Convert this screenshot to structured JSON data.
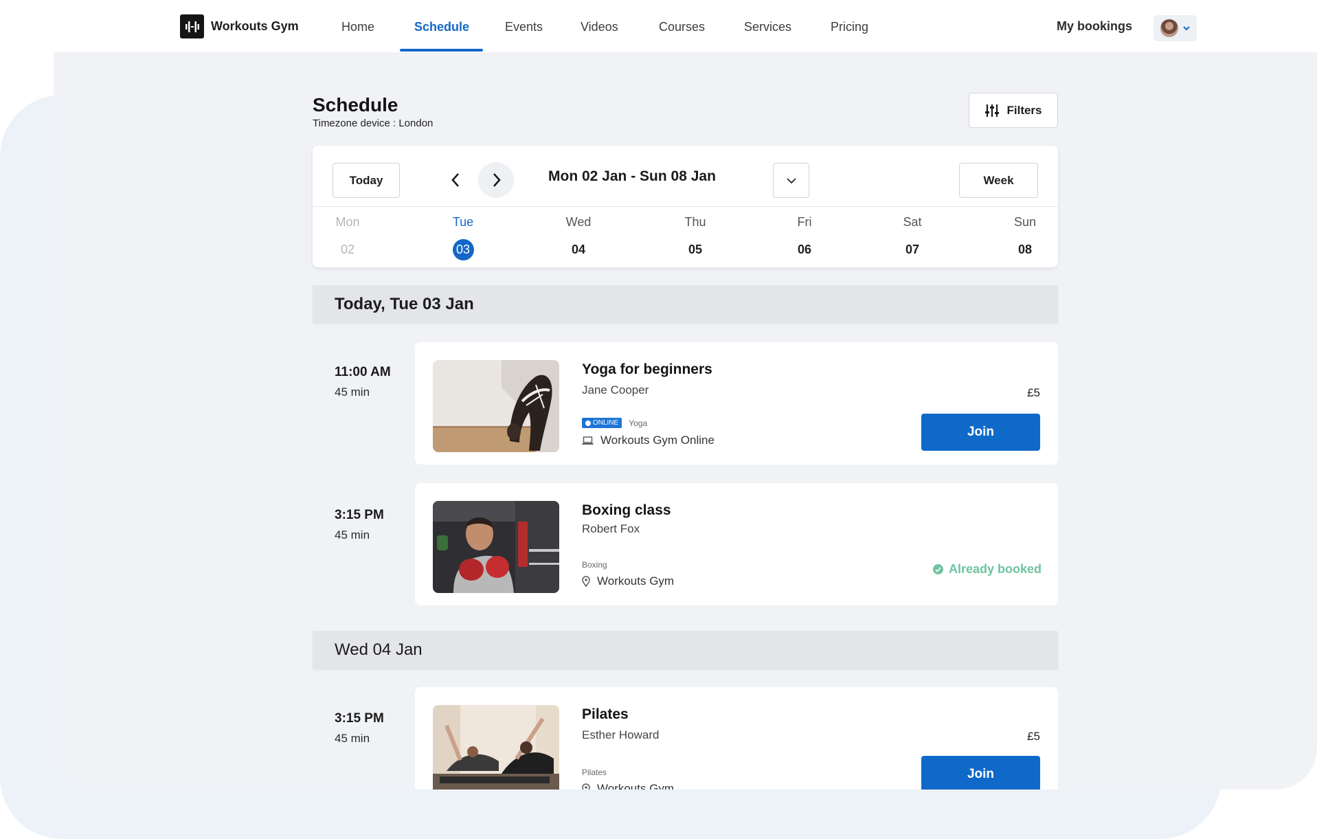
{
  "brand": {
    "name": "Workouts Gym"
  },
  "nav": {
    "items": [
      {
        "label": "Home"
      },
      {
        "label": "Schedule"
      },
      {
        "label": "Events"
      },
      {
        "label": "Videos"
      },
      {
        "label": "Courses"
      },
      {
        "label": "Services"
      },
      {
        "label": "Pricing"
      }
    ],
    "active": "Schedule",
    "my_bookings": "My bookings"
  },
  "page": {
    "title": "Schedule",
    "subtitle": "Timezone device : London",
    "filters_label": "Filters"
  },
  "calendar": {
    "today_label": "Today",
    "range": "Mon 02 Jan - Sun 08 Jan",
    "view_label": "Week",
    "days": [
      {
        "name": "Mon",
        "num": "02",
        "state": "past"
      },
      {
        "name": "Tue",
        "num": "03",
        "state": "selected"
      },
      {
        "name": "Wed",
        "num": "04",
        "state": "normal"
      },
      {
        "name": "Thu",
        "num": "05",
        "state": "normal"
      },
      {
        "name": "Fri",
        "num": "06",
        "state": "normal"
      },
      {
        "name": "Sat",
        "num": "07",
        "state": "normal"
      },
      {
        "name": "Sun",
        "num": "08",
        "state": "normal"
      }
    ]
  },
  "sections": [
    {
      "heading": "Today, Tue 03 Jan"
    },
    {
      "heading": "Wed 04 Jan"
    }
  ],
  "classes": [
    {
      "time": "11:00 AM",
      "duration": "45 min",
      "title": "Yoga for beginners",
      "instructor": "Jane Cooper",
      "badge": "ONLINE",
      "category": "Yoga",
      "location": "Workouts Gym Online",
      "location_icon": "laptop-icon",
      "price": "£5",
      "action": "Join"
    },
    {
      "time": "3:15 PM",
      "duration": "45 min",
      "title": "Boxing class",
      "instructor": "Robert Fox",
      "category": "Boxing",
      "location": "Workouts Gym",
      "location_icon": "map-pin-icon",
      "status": "Already booked"
    },
    {
      "time": "3:15 PM",
      "duration": "45 min",
      "title": "Pilates",
      "instructor": "Esther Howard",
      "category": "Pilates",
      "location": "Workouts Gym",
      "location_icon": "map-pin-icon",
      "price": "£5",
      "action": "Join"
    }
  ],
  "colors": {
    "accent": "#1467c8",
    "button": "#0f69c9",
    "booked": "#6fc3a0",
    "page_bg": "#f0f2f5"
  }
}
